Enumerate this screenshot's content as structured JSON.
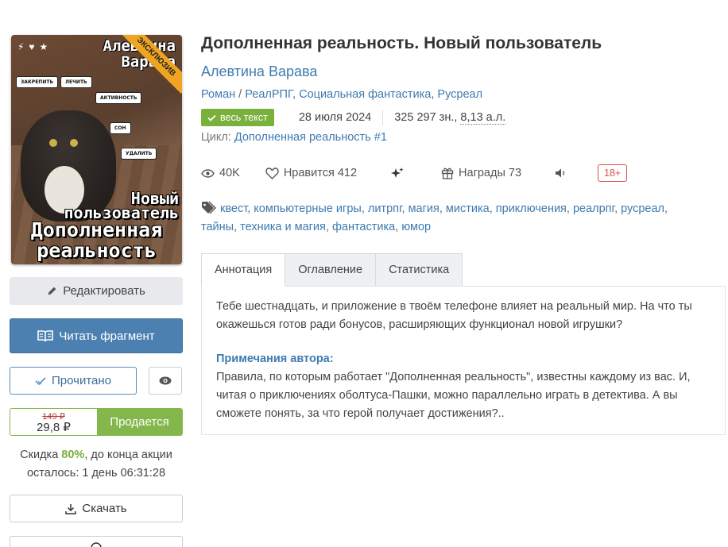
{
  "cover": {
    "author_text": "Алевтина Варава",
    "corner_label": "ЭКСКЛЮЗИВ",
    "title_line1": "Новый пользователь",
    "title_line2": "Дополненная реальность",
    "bubbles": [
      "ЗАКРЕПИТЬ",
      "ЛЕЧИТЬ",
      "АКТИВНОСТЬ",
      "СОН",
      "УДАЛИТЬ"
    ]
  },
  "sidebar": {
    "edit_label": "Редактировать",
    "read_label": "Читать фрагмент",
    "done_label": "Прочитано",
    "old_price": "149 ₽",
    "new_price": "29,8 ₽",
    "sale_label": "Продается",
    "discount_prefix": "Скидка ",
    "discount_value": "80%",
    "discount_suffix": ", до конца акции",
    "discount_line2": "осталось: 1 день 06:31:28",
    "download_label": "Скачать"
  },
  "book": {
    "title": "Дополненная реальность. Новый пользователь",
    "author": "Алевтина Варава",
    "genres": [
      "Роман",
      "РеалРПГ",
      "Социальная фантастика",
      "Русреал"
    ],
    "full_text_badge": "весь текст",
    "date": "28 июля 2024",
    "chars": "325 297 зн.,",
    "al": "8,13 а.л.",
    "cycle_label": "Цикл:",
    "cycle_name": "Дополненная реальность #1",
    "views": "40K",
    "likes": "Нравится 412",
    "awards": "Награды 73",
    "age": "18+",
    "tags": [
      "квест",
      "компьютерные игры",
      "литрпг",
      "магия",
      "мистика",
      "приключения",
      "реалрпг",
      "русреал",
      "тайны",
      "техника и магия",
      "фантастика",
      "юмор"
    ]
  },
  "tabs": [
    "Аннотация",
    "Оглавление",
    "Статистика"
  ],
  "annotation": {
    "text": "Тебе шестнадцать, и приложение в твоём телефоне влияет на реальный мир. На что ты окажешься готов ради бонусов, расширяющих функционал новой игрушки?",
    "notes_heading": "Примечания автора:",
    "notes_text": "Правила, по которым работает \"Дополненная реальность\", известны каждому из вас. И, читая о приключениях оболтуса-Пашки, можно параллельно играть в детектива. А вы сможете понять, за что герой получает достижения?.."
  },
  "colors": {
    "link": "#3e7bb0",
    "read_button": "#4c80b0",
    "green": "#7ab03c",
    "age_red": "#d9534f"
  },
  "icons": [
    "pencil-icon",
    "book-open-icon",
    "check-icon",
    "eye-icon",
    "download-icon",
    "views-icon",
    "heart-icon",
    "sparkle-icon",
    "gift-icon",
    "speaker-icon",
    "tag-icon"
  ]
}
